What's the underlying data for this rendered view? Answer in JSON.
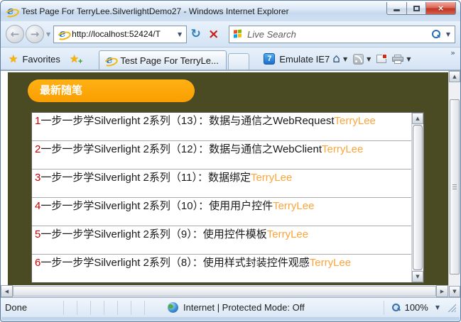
{
  "window": {
    "title": "Test Page For TerryLee.SilverlightDemo27 - Windows Internet Explorer"
  },
  "nav": {
    "url": "http://localhost:52424/T",
    "search_text": "Live Search"
  },
  "command_bar": {
    "favorites_label": "Favorites",
    "tab_title": "Test Page For TerryLe...",
    "emulate_badge": "7",
    "emulate_label": "Emulate IE7"
  },
  "page": {
    "header": "最新随笔",
    "posts": [
      {
        "num": "1",
        "title": "一步一步学Silverlight 2系列（13）：数据与通信之WebRequest",
        "author": "TerryLee"
      },
      {
        "num": "2",
        "title": "一步一步学Silverlight 2系列（12）：数据与通信之WebClient",
        "author": "TerryLee"
      },
      {
        "num": "3",
        "title": "一步一步学Silverlight 2系列（11）：数据绑定",
        "author": "TerryLee"
      },
      {
        "num": "4",
        "title": "一步一步学Silverlight 2系列（10）：使用用户控件",
        "author": "TerryLee"
      },
      {
        "num": "5",
        "title": "一步一步学Silverlight 2系列（9）：使用控件模板",
        "author": "TerryLee"
      },
      {
        "num": "6",
        "title": "一步一步学Silverlight 2系列（8）：使用样式封装控件观感",
        "author": "TerryLee"
      }
    ]
  },
  "status": {
    "message": "Done",
    "zone": "Internet | Protected Mode: Off",
    "zoom": "100%"
  },
  "icons": {
    "ie_logo": "e",
    "back": "←",
    "forward": "→",
    "dropdown": "▼",
    "caret": "▾",
    "refresh": "↻",
    "stop": "×",
    "star": "★",
    "plus": "+",
    "home": "⌂",
    "chevron_more": "»",
    "scroll_up": "▲",
    "scroll_down": "▼",
    "scroll_left": "◀",
    "scroll_right": "▶"
  },
  "colors": {
    "page_background": "#4A4B22",
    "header_background": "#F99E00",
    "post_number": "#CC0000",
    "post_author": "#FFA437"
  }
}
